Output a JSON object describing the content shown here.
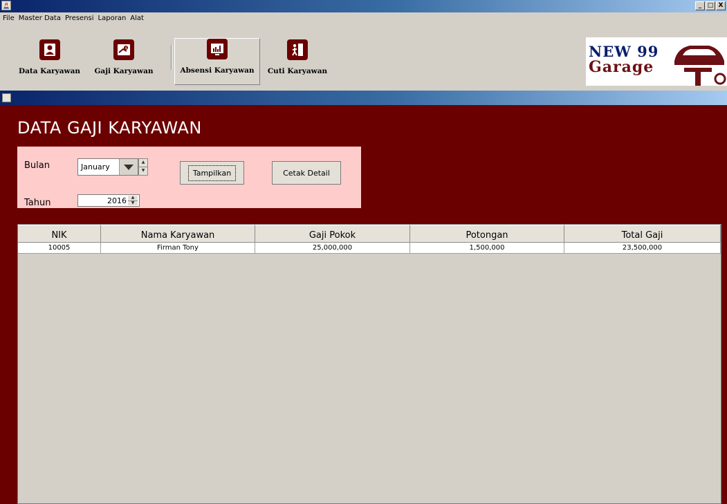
{
  "window": {
    "min_label": "_",
    "max_label": "□",
    "close_label": "X"
  },
  "menu": [
    "File",
    "Master Data",
    "Presensi",
    "Laporan",
    "Alat"
  ],
  "toolbar": {
    "buttons": [
      {
        "label": "Data Karyawan",
        "icon": "employee-id-icon"
      },
      {
        "label": "Gaji Karyawan",
        "icon": "salary-icon"
      },
      {
        "label": "Absensi Karyawan",
        "icon": "attendance-chart-icon"
      },
      {
        "label": "Cuti Karyawan",
        "icon": "leave-door-icon"
      }
    ]
  },
  "logo": {
    "line1": "NEW 99",
    "line2": "Garage",
    "colors": {
      "line1": "#0a1e6e",
      "line2": "#6b1014"
    }
  },
  "page": {
    "title": "DATA GAJI KARYAWAN",
    "background": "#6b0000",
    "panel_background": "#ffcccc"
  },
  "filter": {
    "month_label": "Bulan",
    "month_value": "January",
    "year_label": "Tahun",
    "year_value": "2016",
    "show_button": "Tampilkan",
    "print_button": "Cetak Detail"
  },
  "table": {
    "columns": [
      "NIK",
      "Nama Karyawan",
      "Gaji Pokok",
      "Potongan",
      "Total Gaji"
    ],
    "rows": [
      [
        "10005",
        "Firman Tony",
        "25,000,000",
        "1,500,000",
        "23,500,000"
      ]
    ]
  }
}
